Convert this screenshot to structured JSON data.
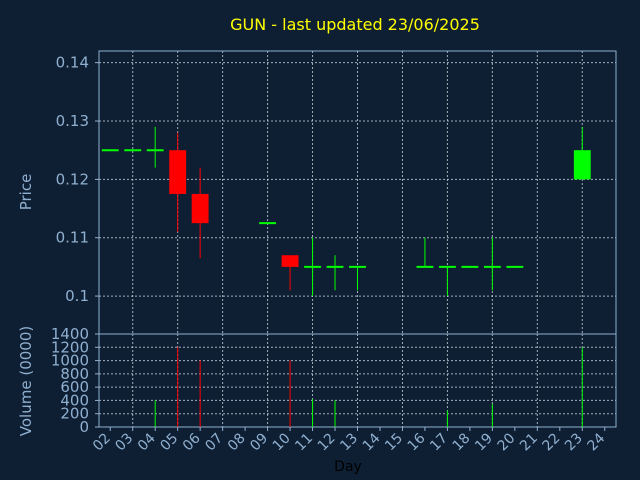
{
  "chart_data": {
    "type": "candlestick",
    "title": "GUN - last updated 23/06/2025",
    "ylabel_price": "Price",
    "ylabel_volume": "Volume (0000)",
    "xlabel": "Day",
    "grid": true,
    "price_ylim": [
      0.0935,
      0.142
    ],
    "price_ticks": [
      "0.14",
      "0.13",
      "0.12",
      "0.11",
      "0.1"
    ],
    "price_tick_values": [
      0.14,
      0.13,
      0.12,
      0.11,
      0.1
    ],
    "volume_ylim": [
      0,
      1400
    ],
    "volume_ticks": [
      "1400",
      "1200",
      "1000",
      "800",
      "600",
      "400",
      "200",
      "0"
    ],
    "volume_tick_values": [
      1400,
      1200,
      1000,
      800,
      600,
      400,
      200,
      0
    ],
    "x_ticks": [
      "02",
      "03",
      "04",
      "05",
      "06",
      "07",
      "08",
      "09",
      "10",
      "11",
      "12",
      "13",
      "14",
      "15",
      "16",
      "17",
      "18",
      "19",
      "20",
      "21",
      "22",
      "23",
      "24"
    ],
    "colors": {
      "background": "#0f1f33",
      "axis": "#8fb0d0",
      "grid": "#c8d2dc",
      "title": "#ffff00",
      "up": "#00ff00",
      "down": "#ff0000",
      "label": "#8fb0d0",
      "xlabel": "#000000"
    },
    "candles": [
      {
        "day": "02",
        "open": 0.125,
        "high": 0.125,
        "low": 0.125,
        "close": 0.125,
        "volume": 0
      },
      {
        "day": "03",
        "open": 0.125,
        "high": 0.125,
        "low": 0.125,
        "close": 0.125,
        "volume": 0
      },
      {
        "day": "04",
        "open": 0.125,
        "high": 0.129,
        "low": 0.122,
        "close": 0.125,
        "volume": 400
      },
      {
        "day": "05",
        "open": 0.125,
        "high": 0.128,
        "low": 0.111,
        "close": 0.1175,
        "volume": 1200
      },
      {
        "day": "06",
        "open": 0.1175,
        "high": 0.122,
        "low": 0.1065,
        "close": 0.1125,
        "volume": 1000
      },
      {
        "day": "09",
        "open": 0.1125,
        "high": 0.1125,
        "low": 0.1125,
        "close": 0.1125,
        "volume": 0
      },
      {
        "day": "10",
        "open": 0.107,
        "high": 0.107,
        "low": 0.101,
        "close": 0.105,
        "volume": 1000
      },
      {
        "day": "11",
        "open": 0.105,
        "high": 0.11,
        "low": 0.1,
        "close": 0.105,
        "volume": 420
      },
      {
        "day": "12",
        "open": 0.105,
        "high": 0.107,
        "low": 0.101,
        "close": 0.105,
        "volume": 400
      },
      {
        "day": "13",
        "open": 0.105,
        "high": 0.105,
        "low": 0.101,
        "close": 0.105,
        "volume": 0
      },
      {
        "day": "16",
        "open": 0.105,
        "high": 0.11,
        "low": 0.105,
        "close": 0.105,
        "volume": 0
      },
      {
        "day": "17",
        "open": 0.105,
        "high": 0.105,
        "low": 0.1,
        "close": 0.105,
        "volume": 250
      },
      {
        "day": "18",
        "open": 0.105,
        "high": 0.105,
        "low": 0.105,
        "close": 0.105,
        "volume": 0
      },
      {
        "day": "19",
        "open": 0.105,
        "high": 0.11,
        "low": 0.101,
        "close": 0.105,
        "volume": 350
      },
      {
        "day": "20",
        "open": 0.105,
        "high": 0.105,
        "low": 0.105,
        "close": 0.105,
        "volume": 0
      },
      {
        "day": "23",
        "open": 0.12,
        "high": 0.129,
        "low": 0.12,
        "close": 0.125,
        "volume": 1200
      }
    ]
  }
}
